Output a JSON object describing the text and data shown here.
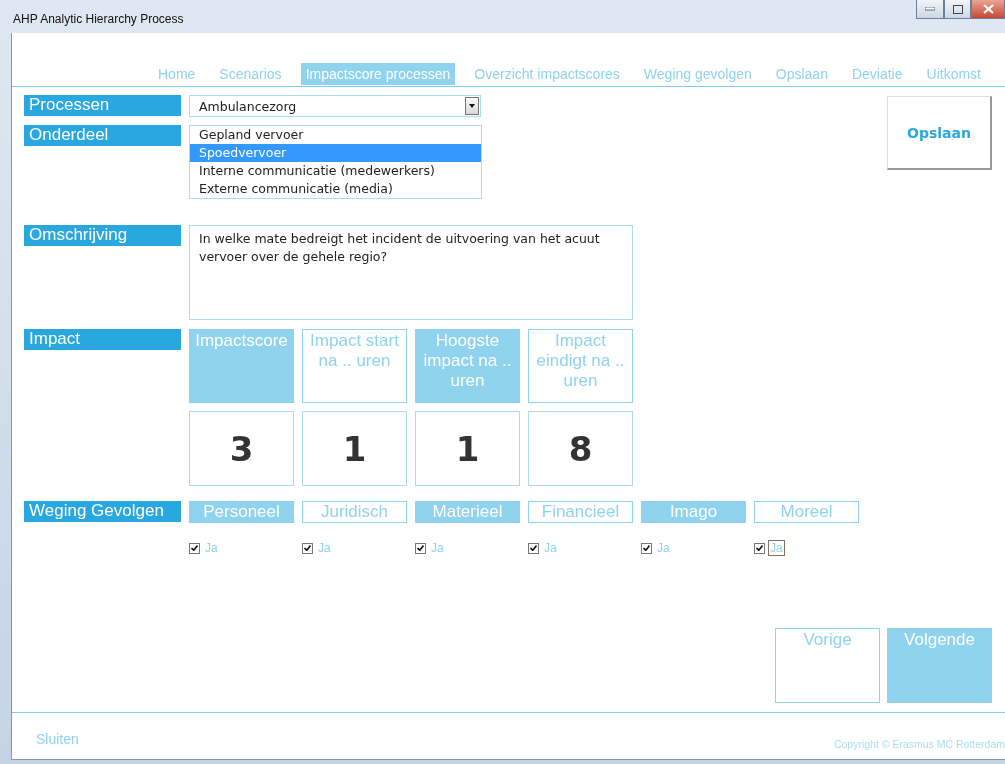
{
  "window": {
    "title": "AHP Analytic Hierarchy Process"
  },
  "nav": [
    {
      "label": "Home",
      "selected": false
    },
    {
      "label": "Scenarios",
      "selected": false
    },
    {
      "label": "Impactscore processen",
      "selected": true
    },
    {
      "label": "Overzicht impactscores",
      "selected": false
    },
    {
      "label": "Weging gevolgen",
      "selected": false
    },
    {
      "label": "Opslaan",
      "selected": false
    },
    {
      "label": "Deviatie",
      "selected": false
    },
    {
      "label": "Uitkomst",
      "selected": false
    }
  ],
  "processen": {
    "label": "Processen",
    "value": "Ambulancezorg"
  },
  "onderdeel": {
    "label": "Onderdeel",
    "options": [
      {
        "label": "Gepland vervoer",
        "selected": false
      },
      {
        "label": "Spoedvervoer",
        "selected": true
      },
      {
        "label": "Interne communicatie (medewerkers)",
        "selected": false
      },
      {
        "label": "Externe communicatie (media)",
        "selected": false
      }
    ]
  },
  "omschrijving": {
    "label": "Omschrijving",
    "text": "In welke mate bedreigt het incident de uitvoering van het acuut vervoer over de gehele regio?"
  },
  "impact": {
    "label": "Impact",
    "columns": [
      {
        "header": "Impactscore",
        "value": "3",
        "filled": true
      },
      {
        "header": "Impact start na .. uren",
        "value": "1",
        "filled": false
      },
      {
        "header": "Hoogste impact na .. uren",
        "value": "1",
        "filled": true
      },
      {
        "header": "Impact eindigt na .. uren",
        "value": "8",
        "filled": false
      }
    ]
  },
  "weging": {
    "label": "Weging Gevolgen",
    "items": [
      {
        "name": "Personeel",
        "filled": true,
        "checkbox_label": "Ja",
        "checked": true,
        "focused": false
      },
      {
        "name": "Juridisch",
        "filled": false,
        "checkbox_label": "Ja",
        "checked": true,
        "focused": false
      },
      {
        "name": "Materieel",
        "filled": true,
        "checkbox_label": "Ja",
        "checked": true,
        "focused": false
      },
      {
        "name": "Financieel",
        "filled": false,
        "checkbox_label": "Ja",
        "checked": true,
        "focused": false
      },
      {
        "name": "Imago",
        "filled": true,
        "checkbox_label": "Ja",
        "checked": true,
        "focused": false
      },
      {
        "name": "Moreel",
        "filled": false,
        "checkbox_label": "Ja",
        "checked": true,
        "focused": true
      }
    ]
  },
  "save_button": "Opslaan",
  "nav_buttons": [
    {
      "label": "Vorige",
      "filled": false
    },
    {
      "label": "Volgende",
      "filled": true
    }
  ],
  "footer": {
    "close": "Sluiten",
    "copyright": "Copyright © Erasmus MC Rotterdam"
  }
}
